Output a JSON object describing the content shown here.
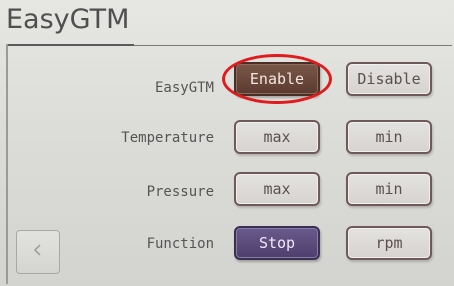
{
  "header": {
    "title": "EasyGTM"
  },
  "rows": [
    {
      "label": "EasyGTM",
      "left_button": "Enable",
      "right_button": "Disable",
      "active": "left"
    },
    {
      "label": "Temperature",
      "left_button": "max",
      "right_button": "min",
      "active": "none"
    },
    {
      "label": "Pressure",
      "left_button": "max",
      "right_button": "min",
      "active": "none"
    },
    {
      "label": "Function",
      "left_button": "Stop",
      "right_button": "rpm",
      "active": "left"
    }
  ],
  "navigation": {
    "back_icon": "chevron-left-icon"
  },
  "colors": {
    "enable_active": "#5b3a2f",
    "stop_active": "#4d3f6c",
    "highlight_ring": "#e01b1b"
  }
}
